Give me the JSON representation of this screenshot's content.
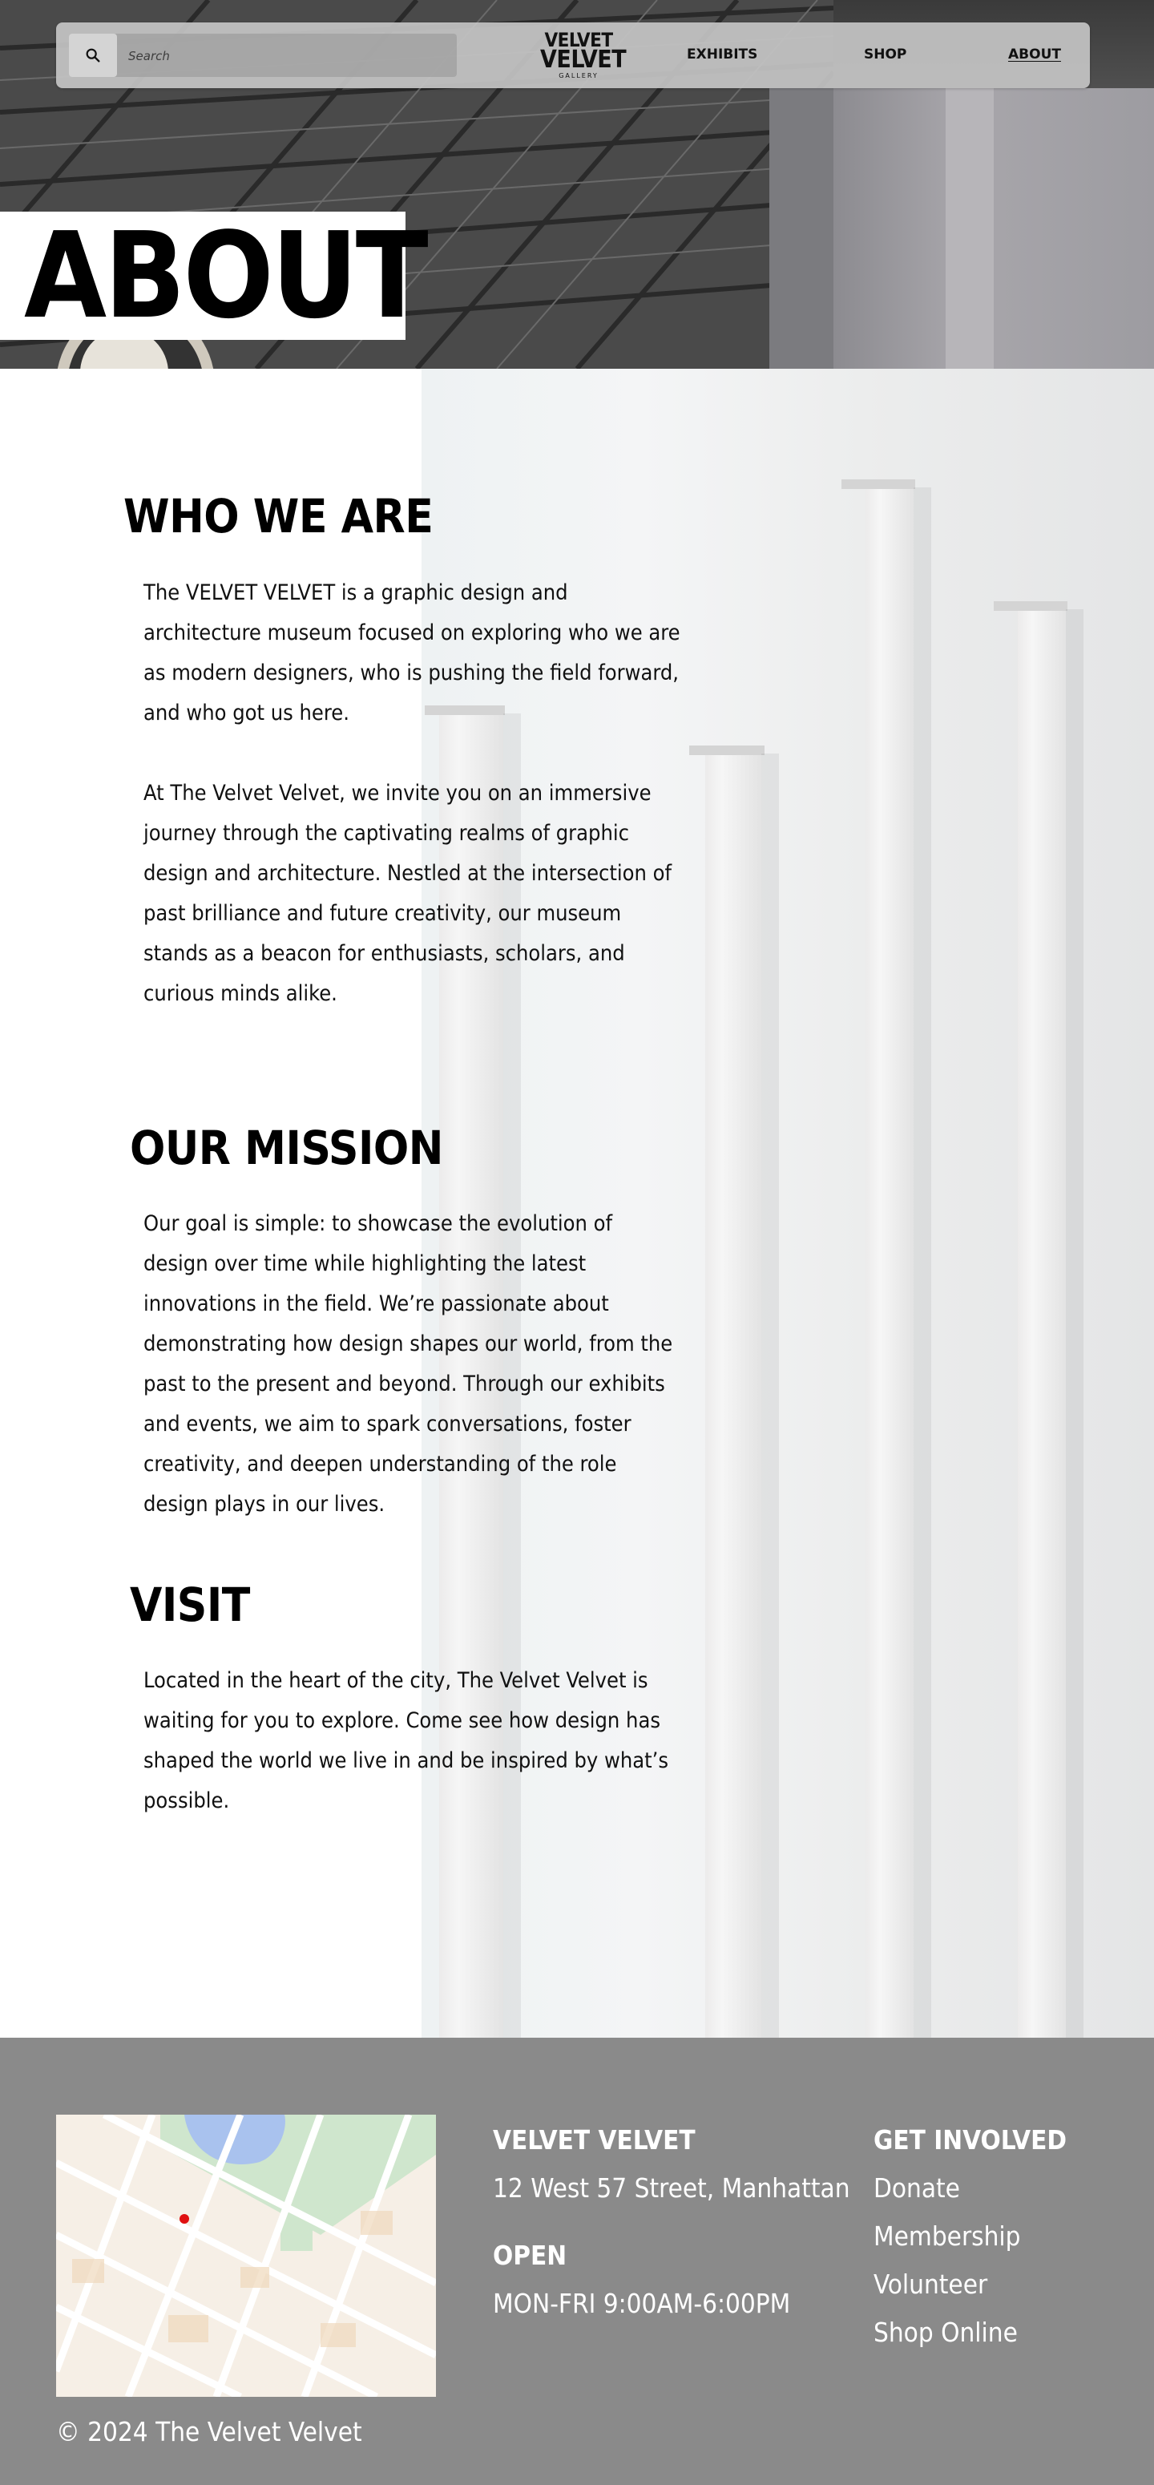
{
  "nav": {
    "search_placeholder": "Search",
    "search_icon": "magnifier-icon",
    "logo_line1": "VELVET",
    "logo_line2": "VELVET",
    "logo_line3": "GALLERY",
    "links": [
      "EXHIBITS",
      "SHOP",
      "ABOUT"
    ],
    "active_link": "ABOUT"
  },
  "hero": {
    "title": "ABOUT"
  },
  "sections": {
    "who": {
      "heading": "WHO WE ARE",
      "p1": "The VELVET VELVET is a graphic design and architecture museum focused on exploring who we are as modern designers, who is pushing the field forward, and who got us here.",
      "p2": "At The Velvet Velvet, we invite you on an immersive journey through the captivating realms of graphic design and architecture. Nestled at the intersection of past brilliance and future creativity, our museum stands as a beacon for enthusiasts, scholars, and curious minds alike."
    },
    "mission": {
      "heading": "OUR MISSION",
      "p1": "Our goal is simple: to showcase the evolution of design over time while highlighting the latest innovations in the field. We’re passionate about demonstrating how design shapes our world, from the past to the present and beyond. Through our exhibits and events, we aim to spark conversations, foster creativity, and deepen understanding of the role design plays in our lives."
    },
    "visit": {
      "heading": "VISIT",
      "p1": "Located in the heart of the city, The Velvet Velvet is waiting for you to explore. Come see how design has shaped the world we live in and be inspired by what’s possible."
    }
  },
  "footer": {
    "name": "VELVET VELVET",
    "address": "12 West 57 Street, Manhattan",
    "open_heading": "OPEN",
    "hours": "MON-FRI 9:00AM-6:00PM",
    "involved_heading": "GET INVOLVED",
    "involved_links": [
      "Donate",
      "Membership",
      "Volunteer",
      "Shop Online"
    ],
    "copyright": "© 2024 The Velvet Velvet"
  },
  "colors": {
    "footer_bg": "#8a8a8a",
    "nav_bg": "#c4c4c4",
    "map_marker": "#e01010"
  }
}
